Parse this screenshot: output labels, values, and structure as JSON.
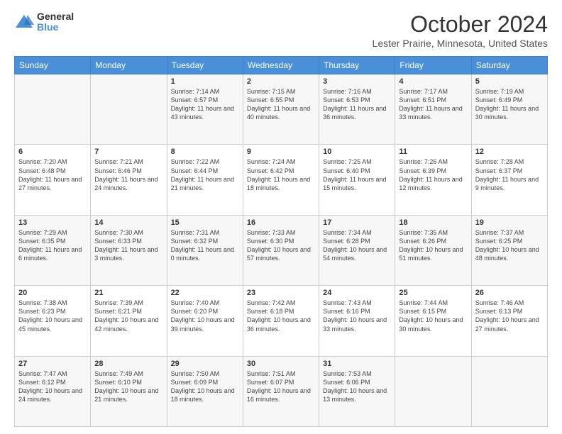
{
  "logo": {
    "general": "General",
    "blue": "Blue"
  },
  "title": "October 2024",
  "location": "Lester Prairie, Minnesota, United States",
  "days_of_week": [
    "Sunday",
    "Monday",
    "Tuesday",
    "Wednesday",
    "Thursday",
    "Friday",
    "Saturday"
  ],
  "weeks": [
    [
      {
        "day": "",
        "info": ""
      },
      {
        "day": "",
        "info": ""
      },
      {
        "day": "1",
        "info": "Sunrise: 7:14 AM\nSunset: 6:57 PM\nDaylight: 11 hours and 43 minutes."
      },
      {
        "day": "2",
        "info": "Sunrise: 7:15 AM\nSunset: 6:55 PM\nDaylight: 11 hours and 40 minutes."
      },
      {
        "day": "3",
        "info": "Sunrise: 7:16 AM\nSunset: 6:53 PM\nDaylight: 11 hours and 36 minutes."
      },
      {
        "day": "4",
        "info": "Sunrise: 7:17 AM\nSunset: 6:51 PM\nDaylight: 11 hours and 33 minutes."
      },
      {
        "day": "5",
        "info": "Sunrise: 7:19 AM\nSunset: 6:49 PM\nDaylight: 11 hours and 30 minutes."
      }
    ],
    [
      {
        "day": "6",
        "info": "Sunrise: 7:20 AM\nSunset: 6:48 PM\nDaylight: 11 hours and 27 minutes."
      },
      {
        "day": "7",
        "info": "Sunrise: 7:21 AM\nSunset: 6:46 PM\nDaylight: 11 hours and 24 minutes."
      },
      {
        "day": "8",
        "info": "Sunrise: 7:22 AM\nSunset: 6:44 PM\nDaylight: 11 hours and 21 minutes."
      },
      {
        "day": "9",
        "info": "Sunrise: 7:24 AM\nSunset: 6:42 PM\nDaylight: 11 hours and 18 minutes."
      },
      {
        "day": "10",
        "info": "Sunrise: 7:25 AM\nSunset: 6:40 PM\nDaylight: 11 hours and 15 minutes."
      },
      {
        "day": "11",
        "info": "Sunrise: 7:26 AM\nSunset: 6:39 PM\nDaylight: 11 hours and 12 minutes."
      },
      {
        "day": "12",
        "info": "Sunrise: 7:28 AM\nSunset: 6:37 PM\nDaylight: 11 hours and 9 minutes."
      }
    ],
    [
      {
        "day": "13",
        "info": "Sunrise: 7:29 AM\nSunset: 6:35 PM\nDaylight: 11 hours and 6 minutes."
      },
      {
        "day": "14",
        "info": "Sunrise: 7:30 AM\nSunset: 6:33 PM\nDaylight: 11 hours and 3 minutes."
      },
      {
        "day": "15",
        "info": "Sunrise: 7:31 AM\nSunset: 6:32 PM\nDaylight: 11 hours and 0 minutes."
      },
      {
        "day": "16",
        "info": "Sunrise: 7:33 AM\nSunset: 6:30 PM\nDaylight: 10 hours and 57 minutes."
      },
      {
        "day": "17",
        "info": "Sunrise: 7:34 AM\nSunset: 6:28 PM\nDaylight: 10 hours and 54 minutes."
      },
      {
        "day": "18",
        "info": "Sunrise: 7:35 AM\nSunset: 6:26 PM\nDaylight: 10 hours and 51 minutes."
      },
      {
        "day": "19",
        "info": "Sunrise: 7:37 AM\nSunset: 6:25 PM\nDaylight: 10 hours and 48 minutes."
      }
    ],
    [
      {
        "day": "20",
        "info": "Sunrise: 7:38 AM\nSunset: 6:23 PM\nDaylight: 10 hours and 45 minutes."
      },
      {
        "day": "21",
        "info": "Sunrise: 7:39 AM\nSunset: 6:21 PM\nDaylight: 10 hours and 42 minutes."
      },
      {
        "day": "22",
        "info": "Sunrise: 7:40 AM\nSunset: 6:20 PM\nDaylight: 10 hours and 39 minutes."
      },
      {
        "day": "23",
        "info": "Sunrise: 7:42 AM\nSunset: 6:18 PM\nDaylight: 10 hours and 36 minutes."
      },
      {
        "day": "24",
        "info": "Sunrise: 7:43 AM\nSunset: 6:16 PM\nDaylight: 10 hours and 33 minutes."
      },
      {
        "day": "25",
        "info": "Sunrise: 7:44 AM\nSunset: 6:15 PM\nDaylight: 10 hours and 30 minutes."
      },
      {
        "day": "26",
        "info": "Sunrise: 7:46 AM\nSunset: 6:13 PM\nDaylight: 10 hours and 27 minutes."
      }
    ],
    [
      {
        "day": "27",
        "info": "Sunrise: 7:47 AM\nSunset: 6:12 PM\nDaylight: 10 hours and 24 minutes."
      },
      {
        "day": "28",
        "info": "Sunrise: 7:49 AM\nSunset: 6:10 PM\nDaylight: 10 hours and 21 minutes."
      },
      {
        "day": "29",
        "info": "Sunrise: 7:50 AM\nSunset: 6:09 PM\nDaylight: 10 hours and 18 minutes."
      },
      {
        "day": "30",
        "info": "Sunrise: 7:51 AM\nSunset: 6:07 PM\nDaylight: 10 hours and 16 minutes."
      },
      {
        "day": "31",
        "info": "Sunrise: 7:53 AM\nSunset: 6:06 PM\nDaylight: 10 hours and 13 minutes."
      },
      {
        "day": "",
        "info": ""
      },
      {
        "day": "",
        "info": ""
      }
    ]
  ]
}
